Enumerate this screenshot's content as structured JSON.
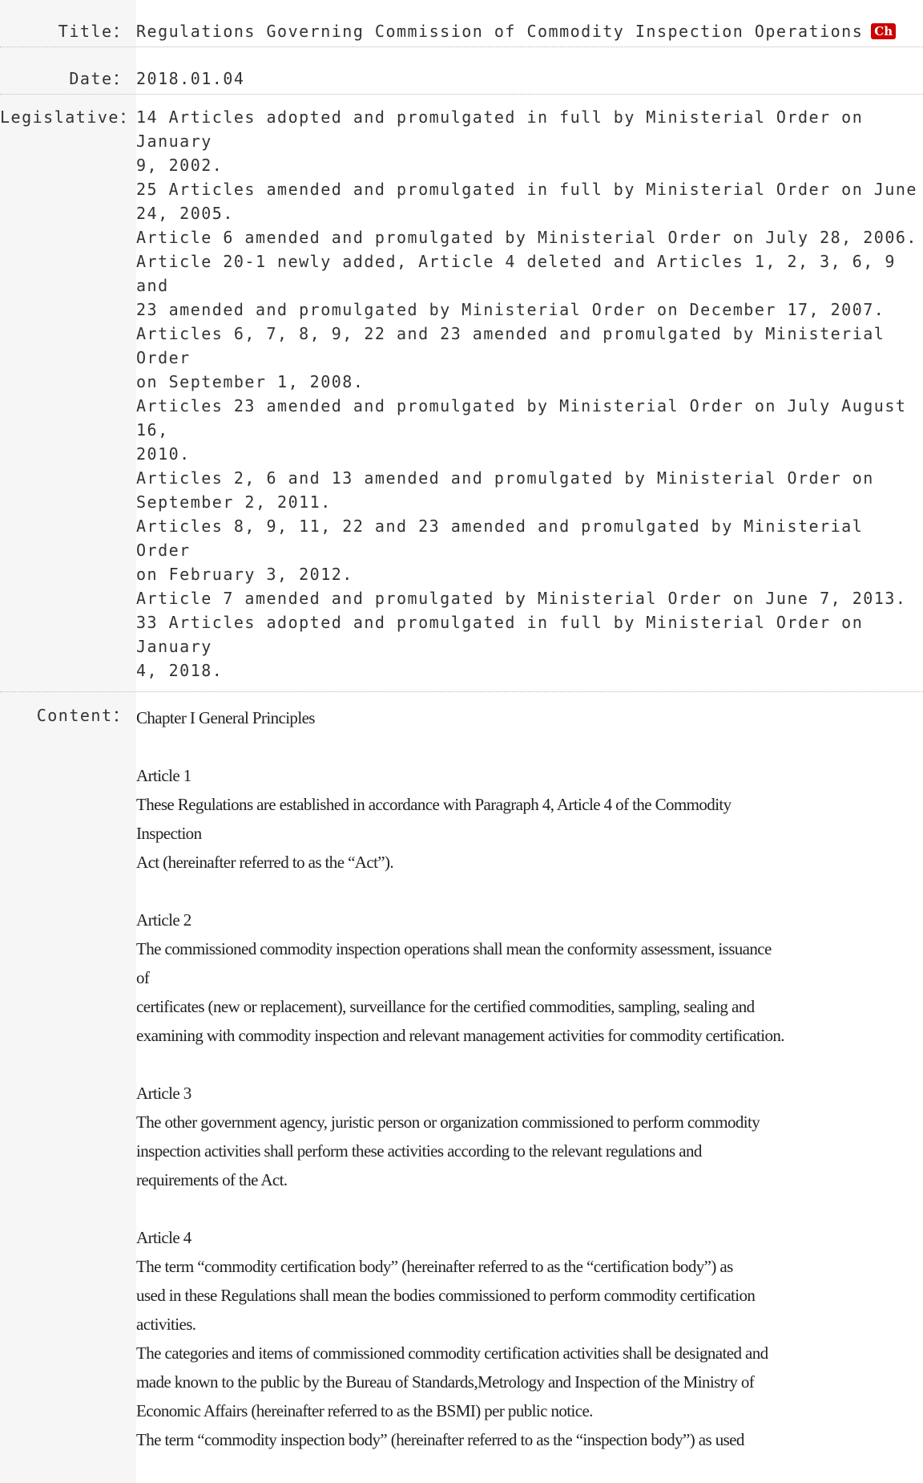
{
  "labels": {
    "title": "Title：",
    "date": "Date：",
    "legislative": "Legislative：",
    "content": "Content："
  },
  "title_text": "Regulations Governing Commission of Commodity Inspection Operations",
  "title_badge": "Ch",
  "badge_color": "#cc0000",
  "date_text": "2018.01.04",
  "legislative_lines": [
    "14 Articles adopted and promulgated in full by Ministerial Order on January",
    "9, 2002.",
    "25 Articles amended and promulgated in full by Ministerial Order on June",
    "24, 2005.",
    "Article 6 amended and promulgated by Ministerial Order on July 28, 2006.",
    "Article 20-1 newly added, Article 4 deleted and Articles 1, 2, 3, 6, 9 and",
    "23 amended and promulgated by Ministerial Order on December 17, 2007.",
    "Articles 6, 7, 8, 9, 22 and 23 amended and promulgated by Ministerial Order",
    "on September 1, 2008.",
    "Articles 23 amended and promulgated by Ministerial Order on July August 16,",
    "2010.",
    "Articles 2, 6 and 13 amended and promulgated by Ministerial Order on",
    "September 2, 2011.",
    "Articles 8, 9, 11, 22 and 23 amended and promulgated by Ministerial Order",
    "on February 3, 2012.",
    "Article 7 amended and promulgated by Ministerial Order on June 7, 2013.",
    "33 Articles adopted and promulgated in full by Ministerial Order on January",
    "4, 2018."
  ],
  "content": {
    "chapter": "Chapter I General Principles",
    "articles": [
      {
        "heading": "Article 1",
        "lines": [
          "These Regulations are established in accordance with Paragraph 4, Article 4 of the Commodity",
          "Inspection",
          "Act (hereinafter referred to as the “Act”)."
        ]
      },
      {
        "heading": "Article 2",
        "lines": [
          "The commissioned commodity inspection operations shall mean the conformity assessment, issuance",
          "of",
          "certificates (new or replacement), surveillance for the certified commodities, sampling, sealing and",
          "examining with commodity inspection and relevant management activities for commodity certification."
        ]
      },
      {
        "heading": "Article 3",
        "lines": [
          "The other government agency, juristic person or organization commissioned to perform commodity",
          "inspection activities shall perform these activities according to the relevant regulations and",
          "requirements of the Act."
        ]
      },
      {
        "heading": "Article 4",
        "lines": [
          "The term “commodity certification body” (hereinafter referred to as the “certification body”) as",
          "used in these Regulations shall mean the bodies commissioned to perform commodity certification",
          "activities.",
          "The categories and items of commissioned commodity certification activities shall be designated and",
          "made known to the public by the Bureau of Standards,Metrology and Inspection of the Ministry of",
          "Economic Affairs (hereinafter referred to as the BSMI) per public notice.",
          "The term “commodity inspection body” (hereinafter referred to as the “inspection body”) as used"
        ]
      }
    ]
  }
}
